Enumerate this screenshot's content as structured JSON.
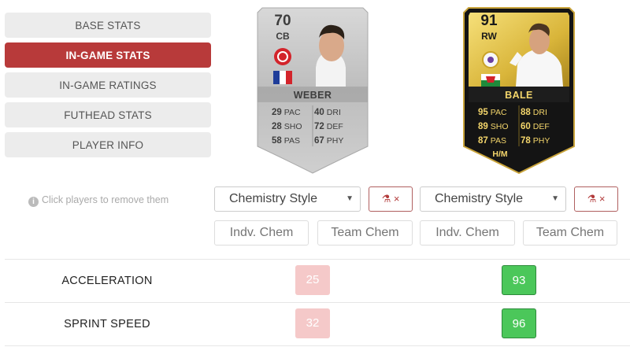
{
  "tabs": [
    {
      "label": "BASE STATS",
      "active": false
    },
    {
      "label": "IN-GAME STATS",
      "active": true
    },
    {
      "label": "IN-GAME RATINGS",
      "active": false
    },
    {
      "label": "FUTHEAD STATS",
      "active": false
    },
    {
      "label": "PLAYER INFO",
      "active": false
    }
  ],
  "players": [
    {
      "name": "WEBER",
      "rating": "70",
      "position": "CB",
      "card_color": "#c9c9c9",
      "stats": [
        {
          "value": "29",
          "label": "PAC"
        },
        {
          "value": "40",
          "label": "DRI"
        },
        {
          "value": "28",
          "label": "SHO"
        },
        {
          "value": "72",
          "label": "DEF"
        },
        {
          "value": "58",
          "label": "PAS"
        },
        {
          "value": "67",
          "label": "PHY"
        }
      ],
      "chemistry_style": "Chemistry Style",
      "indv_chem_placeholder": "Indv. Chem",
      "team_chem_placeholder": "Team Chem"
    },
    {
      "name": "BALE",
      "rating": "91",
      "position": "RW",
      "card_color": "#111111",
      "stats": [
        {
          "value": "95",
          "label": "PAC"
        },
        {
          "value": "88",
          "label": "DRI"
        },
        {
          "value": "89",
          "label": "SHO"
        },
        {
          "value": "60",
          "label": "DEF"
        },
        {
          "value": "87",
          "label": "PAS"
        },
        {
          "value": "78",
          "label": "PHY"
        }
      ],
      "work_rate": "H/M",
      "chemistry_style": "Chemistry Style",
      "indv_chem_placeholder": "Indv. Chem",
      "team_chem_placeholder": "Team Chem"
    }
  ],
  "hint": "Click players to remove them",
  "chem_button_label": "×",
  "comparison": [
    {
      "label": "ACCELERATION",
      "values": [
        "25",
        "93"
      ]
    },
    {
      "label": "SPRINT SPEED",
      "values": [
        "32",
        "96"
      ]
    }
  ],
  "colors": {
    "accent": "#b83a3a",
    "better": "#4bc75a",
    "worse": "#f5c9c9"
  }
}
